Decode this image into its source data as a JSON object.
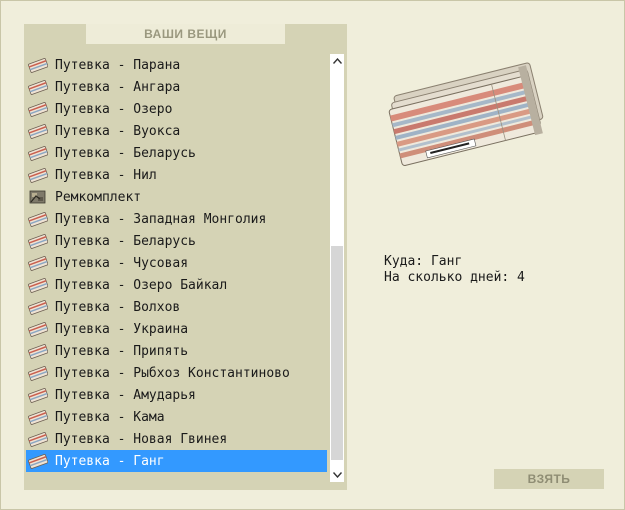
{
  "panel": {
    "title": "ВАШИ ВЕЩИ"
  },
  "items": [
    {
      "label": "Путевка - Парана",
      "icon": "ticket-icon"
    },
    {
      "label": "Путевка - Ангара",
      "icon": "ticket-icon"
    },
    {
      "label": "Путевка - Озеро",
      "icon": "ticket-icon"
    },
    {
      "label": "Путевка - Вуокса",
      "icon": "ticket-icon"
    },
    {
      "label": "Путевка - Беларусь",
      "icon": "ticket-icon"
    },
    {
      "label": "Путевка - Нил",
      "icon": "ticket-icon"
    },
    {
      "label": "Ремкомплект",
      "icon": "repair-kit-icon"
    },
    {
      "label": "Путевка - Западная Монголия",
      "icon": "ticket-icon"
    },
    {
      "label": "Путевка - Беларусь",
      "icon": "ticket-icon"
    },
    {
      "label": "Путевка - Чусовая",
      "icon": "ticket-icon"
    },
    {
      "label": "Путевка - Озеро Байкал",
      "icon": "ticket-icon"
    },
    {
      "label": "Путевка - Волхов",
      "icon": "ticket-icon"
    },
    {
      "label": "Путевка - Украина",
      "icon": "ticket-icon"
    },
    {
      "label": "Путевка - Припять",
      "icon": "ticket-icon"
    },
    {
      "label": "Путевка - Рыбхоз Константиново",
      "icon": "ticket-icon"
    },
    {
      "label": "Путевка - Амударья",
      "icon": "ticket-icon"
    },
    {
      "label": "Путевка - Кама",
      "icon": "ticket-icon"
    },
    {
      "label": "Путевка - Новая Гвинея",
      "icon": "ticket-icon"
    },
    {
      "label": "Путевка - Ганг",
      "icon": "ticket-icon",
      "selected": true
    }
  ],
  "details": {
    "destination_line": "Куда: Ганг",
    "days_line": "На сколько дней: 4"
  },
  "actions": {
    "take_label": "ВЗЯТЬ"
  },
  "colors": {
    "background": "#efedda",
    "panel": "#d5d3b5",
    "selection": "#3399ff",
    "header_text": "#9a987f"
  }
}
